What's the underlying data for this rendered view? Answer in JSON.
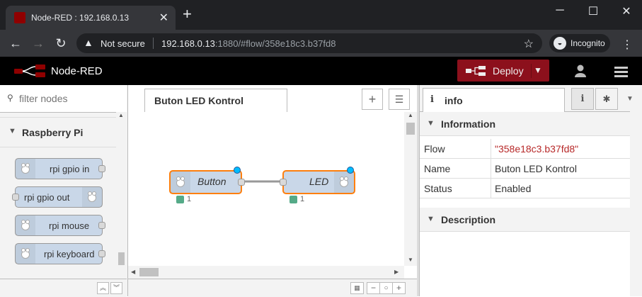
{
  "browser": {
    "tab_title": "Node-RED : 192.168.0.13",
    "close_glyph": "✕",
    "new_tab_glyph": "+",
    "not_secure": "Not secure",
    "url_host": "192.168.0.13",
    "url_rest": ":1880/#flow/358e18c3.b37fd8",
    "incognito": "Incognito",
    "icons": [
      "back-icon",
      "forward-icon",
      "reload-icon",
      "warning-icon",
      "star-icon",
      "incognito-icon",
      "menu-icon",
      "minimize-icon",
      "maximize-icon",
      "close-icon"
    ]
  },
  "header": {
    "app_title": "Node-RED",
    "deploy_label": "Deploy",
    "accent": "#8c101c"
  },
  "palette": {
    "filter_placeholder": "filter nodes",
    "category": "Raspberry Pi",
    "nodes": [
      {
        "label": "rpi gpio in"
      },
      {
        "label": "rpi gpio out"
      },
      {
        "label": "rpi mouse"
      },
      {
        "label": "rpi keyboard"
      }
    ]
  },
  "workspace": {
    "tab_label": "Buton LED Kontrol",
    "flow_nodes": [
      {
        "label": "Button",
        "status": "1"
      },
      {
        "label": "LED",
        "status": "1"
      }
    ]
  },
  "sidebar": {
    "tab_label": "info",
    "information_header": "Information",
    "props": [
      {
        "key": "Flow",
        "value": "\"358e18c3.b37fd8\""
      },
      {
        "key": "Name",
        "value": "Buton LED Kontrol"
      },
      {
        "key": "Status",
        "value": "Enabled"
      }
    ],
    "description_header": "Description"
  }
}
